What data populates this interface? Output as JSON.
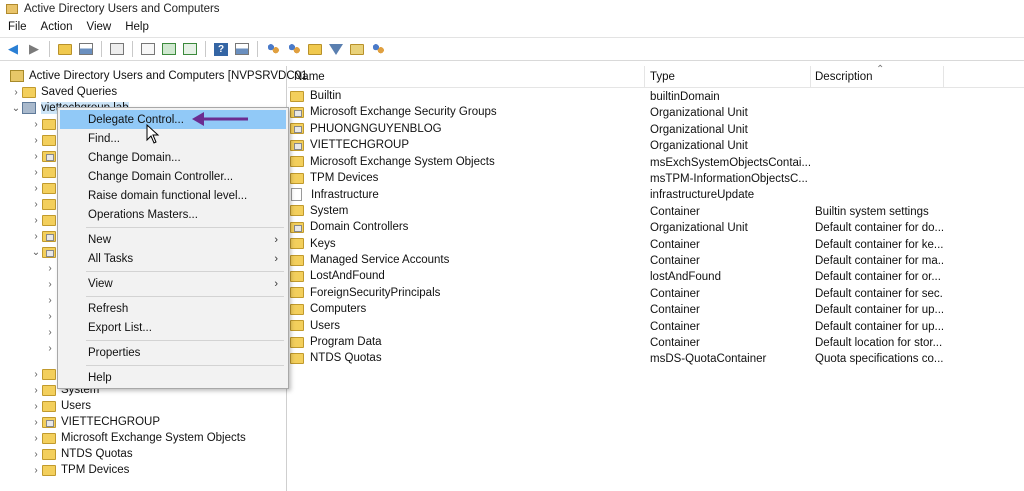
{
  "window": {
    "title": "Active Directory Users and Computers"
  },
  "menubar": [
    "File",
    "Action",
    "View",
    "Help"
  ],
  "toolbar": {
    "icons": [
      "back-icon",
      "forward-icon",
      "up-folder-icon",
      "show-tree-icon",
      "copy-icon",
      "properties-icon",
      "refresh-icon",
      "export-icon",
      "help-icon",
      "console-icon",
      "user-icon",
      "group-icon",
      "ou-icon",
      "filter-icon",
      "find-icon",
      "delegate-icon"
    ]
  },
  "tree": {
    "root_label": "Active Directory Users and Computers [NVPSRVDC01",
    "saved_queries": "Saved Queries",
    "domain_label": "viettechgroup.lab",
    "visible_children": [
      "System",
      "Users",
      "VIETTECHGROUP",
      "Microsoft Exchange System Objects",
      "NTDS Quotas",
      "TPM Devices"
    ]
  },
  "list": {
    "columns": {
      "name": "Name",
      "type": "Type",
      "description": "Description"
    },
    "rows": [
      {
        "name": "Builtin",
        "type": "builtinDomain",
        "description": "",
        "icon": "folder"
      },
      {
        "name": "Microsoft Exchange Security Groups",
        "type": "Organizational Unit",
        "description": "",
        "icon": "ou"
      },
      {
        "name": "PHUONGNGUYENBLOG",
        "type": "Organizational Unit",
        "description": "",
        "icon": "ou"
      },
      {
        "name": "VIETTECHGROUP",
        "type": "Organizational Unit",
        "description": "",
        "icon": "ou"
      },
      {
        "name": "Microsoft Exchange System Objects",
        "type": "msExchSystemObjectsContai...",
        "description": "",
        "icon": "folder"
      },
      {
        "name": "TPM Devices",
        "type": "msTPM-InformationObjectsC...",
        "description": "",
        "icon": "folder"
      },
      {
        "name": "Infrastructure",
        "type": "infrastructureUpdate",
        "description": "",
        "icon": "doc"
      },
      {
        "name": "System",
        "type": "Container",
        "description": "Builtin system settings",
        "icon": "folder"
      },
      {
        "name": "Domain Controllers",
        "type": "Organizational Unit",
        "description": "Default container for do...",
        "icon": "ou"
      },
      {
        "name": "Keys",
        "type": "Container",
        "description": "Default container for ke...",
        "icon": "folder"
      },
      {
        "name": "Managed Service Accounts",
        "type": "Container",
        "description": "Default container for ma...",
        "icon": "folder"
      },
      {
        "name": "LostAndFound",
        "type": "lostAndFound",
        "description": "Default container for or...",
        "icon": "folder"
      },
      {
        "name": "ForeignSecurityPrincipals",
        "type": "Container",
        "description": "Default container for sec...",
        "icon": "folder"
      },
      {
        "name": "Computers",
        "type": "Container",
        "description": "Default container for up...",
        "icon": "folder"
      },
      {
        "name": "Users",
        "type": "Container",
        "description": "Default container for up...",
        "icon": "folder"
      },
      {
        "name": "Program Data",
        "type": "Container",
        "description": "Default location for stor...",
        "icon": "folder"
      },
      {
        "name": "NTDS Quotas",
        "type": "msDS-QuotaContainer",
        "description": "Quota specifications co...",
        "icon": "folder"
      }
    ]
  },
  "context_menu": {
    "items": [
      {
        "label": "Delegate Control...",
        "highlighted": true
      },
      {
        "label": "Find..."
      },
      {
        "label": "Change Domain..."
      },
      {
        "label": "Change Domain Controller..."
      },
      {
        "label": "Raise domain functional level..."
      },
      {
        "label": "Operations Masters..."
      },
      {
        "label": "New",
        "submenu": true
      },
      {
        "label": "All Tasks",
        "submenu": true
      },
      {
        "label": "View",
        "submenu": true
      },
      {
        "label": "Refresh"
      },
      {
        "label": "Export List..."
      },
      {
        "label": "Properties"
      },
      {
        "label": "Help"
      }
    ]
  },
  "colors": {
    "highlight": "#91c9f7",
    "annotation_arrow": "#6b2c91",
    "folder": "#f3cf5c"
  }
}
